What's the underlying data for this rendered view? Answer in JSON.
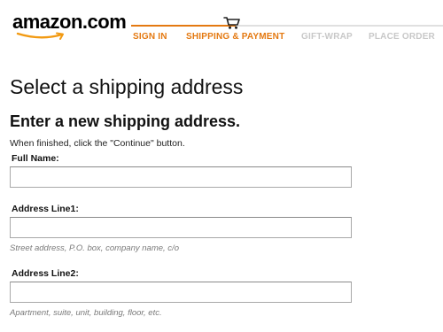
{
  "brand": {
    "logo_text": "amazon.com",
    "accent_color": "#e47911"
  },
  "checkout_steps": {
    "icon": "shopping-cart-icon",
    "steps": [
      {
        "label": "SIGN IN",
        "state": "done"
      },
      {
        "label": "SHIPPING & PAYMENT",
        "state": "current"
      },
      {
        "label": "GIFT-WRAP",
        "state": "upcoming"
      },
      {
        "label": "PLACE ORDER",
        "state": "upcoming"
      }
    ]
  },
  "main": {
    "page_title": "Select a shipping address",
    "section_title": "Enter a new shipping address.",
    "instructions": "When finished, click the \"Continue\" button.",
    "fields": {
      "full_name": {
        "label": "Full Name:",
        "value": ""
      },
      "address_line1": {
        "label": "Address Line1:",
        "value": "",
        "hint": "Street address, P.O. box, company name, c/o"
      },
      "address_line2": {
        "label": "Address Line2:",
        "value": "",
        "hint": "Apartment, suite, unit, building, floor, etc."
      }
    }
  }
}
